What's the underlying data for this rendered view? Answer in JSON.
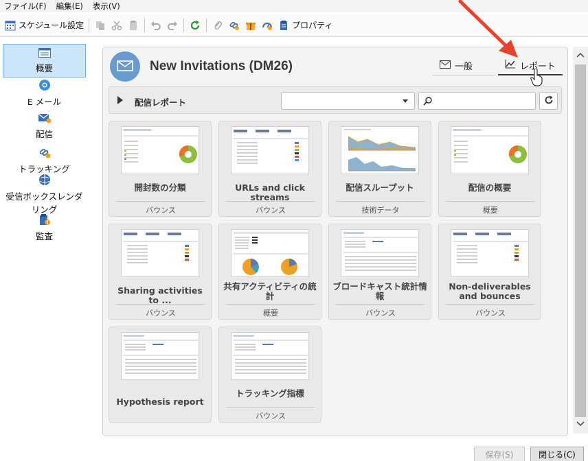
{
  "menu": [
    "ファイル(F)",
    "編集(E)",
    "表示(V)"
  ],
  "toolbar": {
    "schedule_label": "スケジュール設定",
    "properties_label": "プロパティ"
  },
  "sidebar": {
    "items": [
      {
        "label": "概要",
        "icon": "overview-icon"
      },
      {
        "label": "E メール",
        "icon": "email-icon"
      },
      {
        "label": "配信",
        "icon": "delivery-icon"
      },
      {
        "label": "トラッキング",
        "icon": "tracking-icon"
      },
      {
        "label": "受信ボックスレンダリング",
        "icon": "inbox-rendering-icon"
      },
      {
        "label": "監査",
        "icon": "audit-icon"
      }
    ]
  },
  "main": {
    "title": "New Invitations (DM26)",
    "tabs": [
      {
        "label": "一般"
      },
      {
        "label": "レポート"
      }
    ],
    "report_bar": {
      "label": "配信レポート",
      "select_value": "",
      "search_value": ""
    },
    "reports": [
      {
        "title": "開封数の分類",
        "category": "バウンス"
      },
      {
        "title": "URLs and click streams",
        "category": "バウンス"
      },
      {
        "title": "配信スループット",
        "category": "技術データ"
      },
      {
        "title": "配信の概要",
        "category": "概要"
      },
      {
        "title": "Sharing activities to ...",
        "category": "バウンス"
      },
      {
        "title": "共有アクティビティの統計",
        "category": "概要"
      },
      {
        "title": "ブロードキャスト統計情報",
        "category": "バウンス"
      },
      {
        "title": "Non-deliverables and bounces",
        "category": "バウンス"
      },
      {
        "title": "Hypothesis report",
        "category": ""
      },
      {
        "title": "トラッキング指標",
        "category": "バウンス"
      }
    ]
  },
  "buttons": {
    "save": "保存(S)",
    "close": "閉じる(C)"
  },
  "colors": {
    "accent": "#6a9bcf",
    "active_nav": "#cde5fb",
    "arrow": "#e8412c"
  }
}
